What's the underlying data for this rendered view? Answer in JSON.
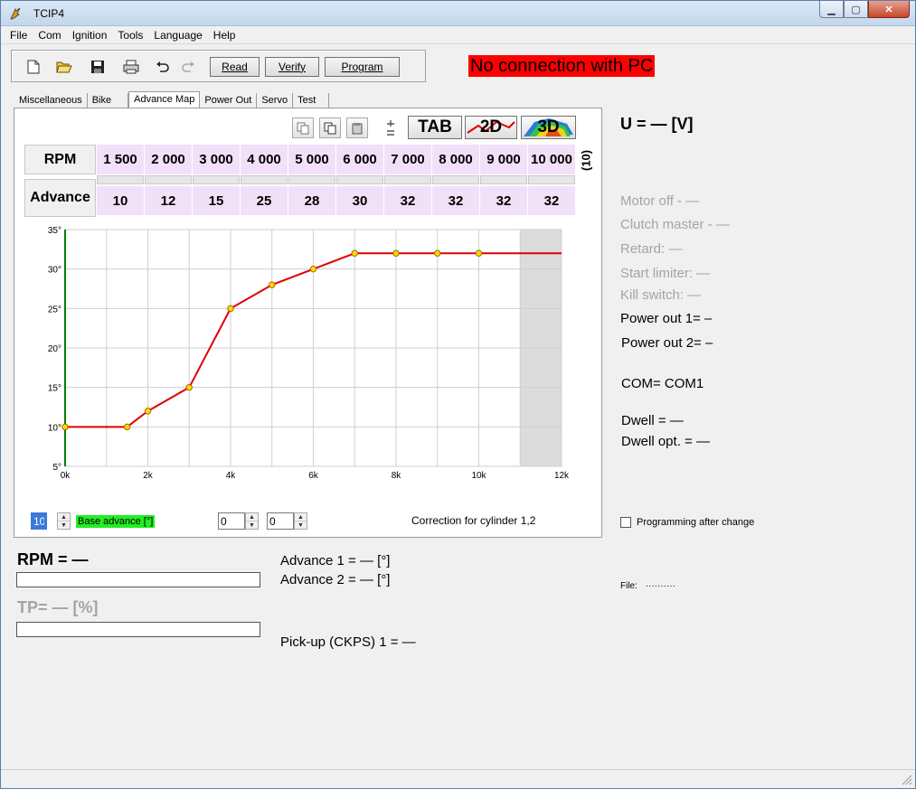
{
  "window": {
    "title": "TCIP4"
  },
  "menu": [
    "File",
    "Com",
    "Ignition",
    "Tools",
    "Language",
    "Help"
  ],
  "toolbar": {
    "read_label": "Read",
    "verify_label": "Verify",
    "program_label": "Program"
  },
  "status": {
    "connection": "No connection with PC"
  },
  "tabs": [
    "Miscellaneous",
    "Bike",
    "Advance Map",
    "Power Out",
    "Servo",
    "Test"
  ],
  "view_buttons": {
    "tab": "TAB",
    "d2": "2D",
    "d3": "3D"
  },
  "table": {
    "rpm_header": "RPM",
    "advance_header": "Advance",
    "count": "(10)",
    "rpm": [
      "1 500",
      "2 000",
      "3 000",
      "4 000",
      "5 000",
      "6 000",
      "7 000",
      "8 000",
      "9 000",
      "10 000"
    ],
    "advance": [
      "10",
      "12",
      "15",
      "25",
      "28",
      "30",
      "32",
      "32",
      "32",
      "32"
    ]
  },
  "chart_data": {
    "type": "line",
    "x": [
      0,
      1500,
      2000,
      3000,
      4000,
      5000,
      6000,
      7000,
      8000,
      9000,
      10000,
      12000
    ],
    "y": [
      10,
      10,
      12,
      15,
      25,
      28,
      30,
      32,
      32,
      32,
      32,
      32
    ],
    "points_x": [
      0,
      1500,
      2000,
      3000,
      4000,
      5000,
      6000,
      7000,
      8000,
      9000,
      10000
    ],
    "xlim": [
      0,
      12000
    ],
    "ylim": [
      5,
      35
    ],
    "xticks": [
      "0k",
      "2k",
      "4k",
      "6k",
      "8k",
      "10k",
      "12k"
    ],
    "yticks": [
      "35°",
      "30°",
      "25°",
      "20°",
      "15°",
      "10°",
      "5°"
    ],
    "shaded_from": 11000,
    "grid": true,
    "line_color": "#dd0000",
    "point_color": "#ffdd00"
  },
  "controls": {
    "base_value": "10",
    "base_label": "Base advance [°]",
    "spin2": "0",
    "spin3": "0",
    "correction_label": "Correction for cylinder 1,2"
  },
  "right": {
    "voltage": "U = — [V]",
    "motor_off": "Motor off - —",
    "clutch_master": "Clutch master - —",
    "retard": "Retard: —",
    "start_limiter": "Start limiter: —",
    "kill_switch": "Kill switch: —",
    "power_out_1": "Power out 1= –",
    "power_out_2": "Power out 2= –",
    "com": "COM= COM1",
    "dwell": "Dwell = —",
    "dwell_opt": "Dwell opt. = —",
    "programming_after_change": "Programming after change",
    "file_label": "File:",
    "file_value": "··········"
  },
  "bottom": {
    "rpm": "RPM = —",
    "tp": "TP= — [%]",
    "advance_1": "Advance 1 = — [°]",
    "advance_2": "Advance 2 = — [°]",
    "pickup": "Pick-up (CKPS) 1 = —"
  },
  "colors": {
    "no_connection_bg": "#ff0000",
    "table_cell": "#f2e0f8",
    "base_label_bg": "#22ee22"
  }
}
